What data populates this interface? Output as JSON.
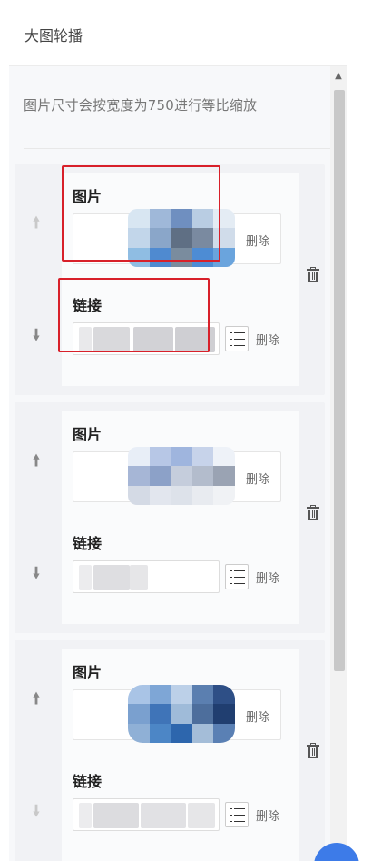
{
  "header": {
    "title": "大图轮播"
  },
  "panel": {
    "note": "图片尺寸会按宽度为750进行等比缩放"
  },
  "items": [
    {
      "image_label": "图片",
      "link_label": "链接",
      "delete_image": "删除",
      "delete_link": "删除",
      "up_enabled": false,
      "down_enabled": true
    },
    {
      "image_label": "图片",
      "link_label": "链接",
      "delete_image": "删除",
      "delete_link": "删除",
      "up_enabled": true,
      "down_enabled": true
    },
    {
      "image_label": "图片",
      "link_label": "链接",
      "delete_image": "删除",
      "delete_link": "删除",
      "up_enabled": true,
      "down_enabled": false
    }
  ],
  "icons": {
    "up": "up-arrow-icon",
    "down": "down-arrow-icon",
    "trash": "trash-icon",
    "list": "list-select-icon"
  },
  "colors": {
    "highlight": "#d8202a",
    "panel_bg": "#f7f8fa",
    "fab": "#3d7be8"
  }
}
